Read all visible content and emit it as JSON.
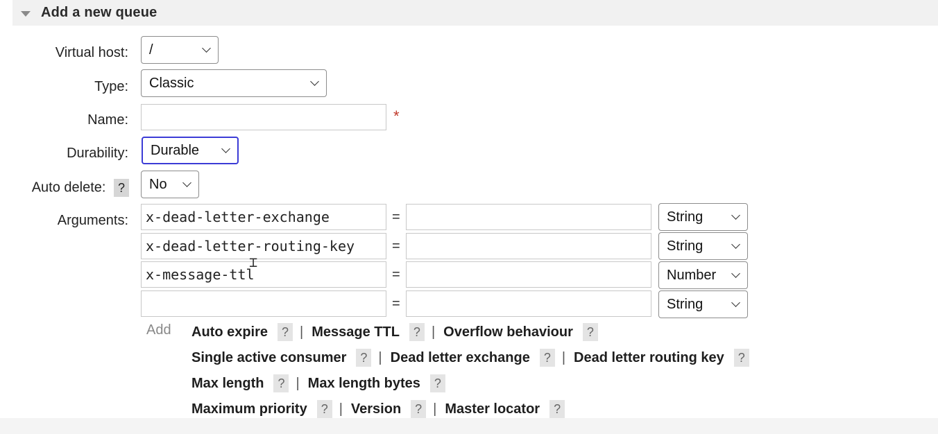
{
  "section": {
    "title": "Add a new queue"
  },
  "form": {
    "virtual_host": {
      "label": "Virtual host:",
      "value": "/"
    },
    "type": {
      "label": "Type:",
      "value": "Classic"
    },
    "name": {
      "label": "Name:",
      "value": "",
      "required_marker": "*"
    },
    "durability": {
      "label": "Durability:",
      "value": "Durable"
    },
    "auto_delete": {
      "label": "Auto delete:",
      "help": "?",
      "value": "No"
    },
    "arguments": {
      "label": "Arguments:",
      "equals": "=",
      "rows": [
        {
          "key": "x-dead-letter-exchange",
          "value": "",
          "type": "String"
        },
        {
          "key": "x-dead-letter-routing-key",
          "value": "",
          "type": "String"
        },
        {
          "key": "x-message-ttl",
          "value": "",
          "type": "Number"
        },
        {
          "key": "",
          "value": "",
          "type": "String"
        }
      ]
    }
  },
  "add_label": "Add",
  "help_glyph": "?",
  "separator": "|",
  "shortcuts": [
    [
      "Auto expire",
      "Message TTL",
      "Overflow behaviour"
    ],
    [
      "Single active consumer",
      "Dead letter exchange",
      "Dead letter routing key"
    ],
    [
      "Max length",
      "Max length bytes"
    ],
    [
      "Maximum priority",
      "Version",
      "Master locator"
    ]
  ]
}
